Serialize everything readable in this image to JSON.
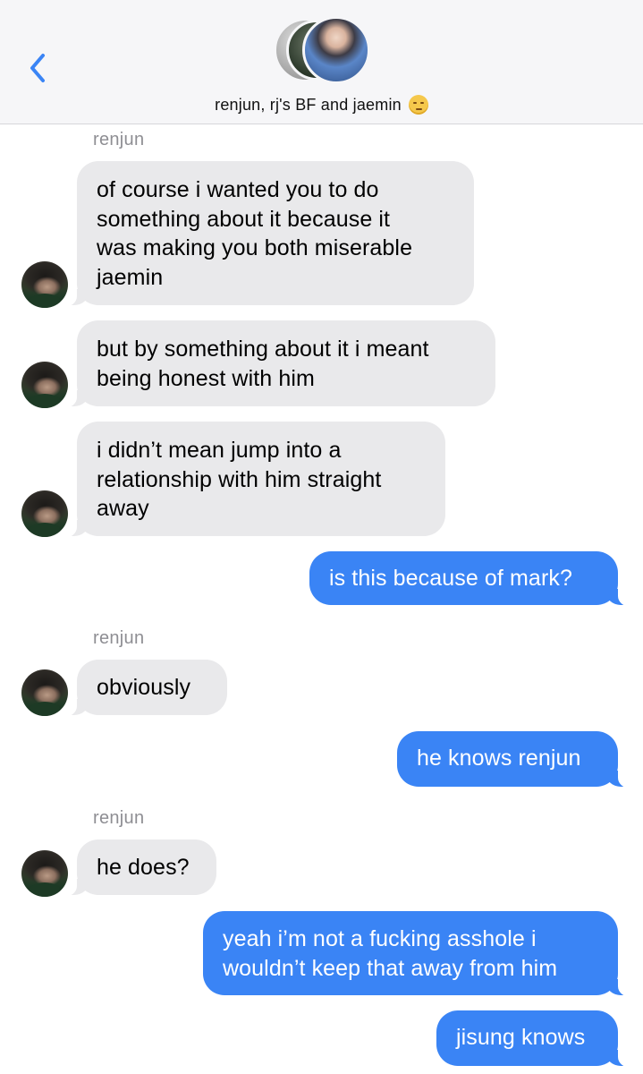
{
  "header": {
    "back_icon": "chevron-left-icon",
    "title": "renjun, rj's BF and jaemin",
    "title_emoji": "unamused-face-emoji",
    "accent": "#3a84f5"
  },
  "colors": {
    "incoming_bubble": "#e9e9eb",
    "outgoing_bubble": "#3a84f5",
    "sender_label": "#8e8e93"
  },
  "messages": {
    "sender_1": "renjun",
    "m1": "of course i wanted you to do\nsomething about it because it\nwas making you both miserable\njaemin",
    "m2": "but by something about it i meant\nbeing honest with him",
    "m3": "i didn’t mean jump into a\nrelationship with him straight\naway",
    "m4": "is this because of mark?",
    "sender_2": "renjun",
    "m5": "obviously",
    "m6": "he knows renjun",
    "sender_3": "renjun",
    "m7": "he does?",
    "m8": "yeah i’m not a fucking asshole i\nwouldn’t keep that away from him",
    "m9": "jisung knows"
  }
}
